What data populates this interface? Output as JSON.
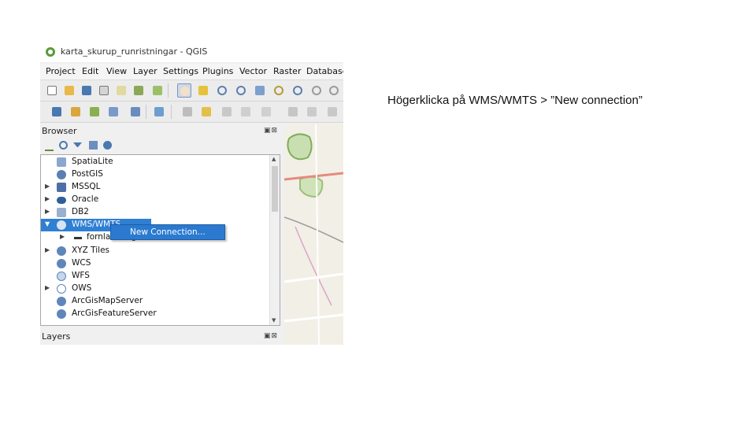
{
  "window": {
    "title": "karta_skurup_runristningar - QGIS"
  },
  "menubar": {
    "items": [
      "Project",
      "Edit",
      "View",
      "Layer",
      "Settings",
      "Plugins",
      "Vector",
      "Raster",
      "Database"
    ]
  },
  "browser": {
    "title": "Browser",
    "items": [
      {
        "label": "SpatiaLite",
        "icon": "feather-icon",
        "expandable": false
      },
      {
        "label": "PostGIS",
        "icon": "elephant-icon",
        "expandable": false
      },
      {
        "label": "MSSQL",
        "icon": "mssql-icon",
        "expandable": true
      },
      {
        "label": "Oracle",
        "icon": "oracle-icon",
        "expandable": true
      },
      {
        "label": "DB2",
        "icon": "db2-icon",
        "expandable": true
      },
      {
        "label": "WMS/WMTS",
        "icon": "globe-icon",
        "expandable": true,
        "selected": true
      },
      {
        "label": "fornlamningar",
        "icon": "layer-icon",
        "expandable": true
      },
      {
        "label": "XYZ Tiles",
        "icon": "globe-icon",
        "expandable": true
      },
      {
        "label": "WCS",
        "icon": "globe-icon",
        "expandable": false
      },
      {
        "label": "WFS",
        "icon": "wfs-icon",
        "expandable": false
      },
      {
        "label": "OWS",
        "icon": "ows-icon",
        "expandable": true
      },
      {
        "label": "ArcGisMapServer",
        "icon": "globe-icon",
        "expandable": false
      },
      {
        "label": "ArcGisFeatureServer",
        "icon": "globe-icon",
        "expandable": false
      }
    ]
  },
  "context_menu": {
    "new_connection": "New Connection..."
  },
  "layers": {
    "title": "Layers"
  },
  "caption": "Högerklicka på WMS/WMTS > ”New connection”",
  "colors": {
    "selection": "#2f7fd2",
    "qgis_green": "#5a9a3a"
  }
}
